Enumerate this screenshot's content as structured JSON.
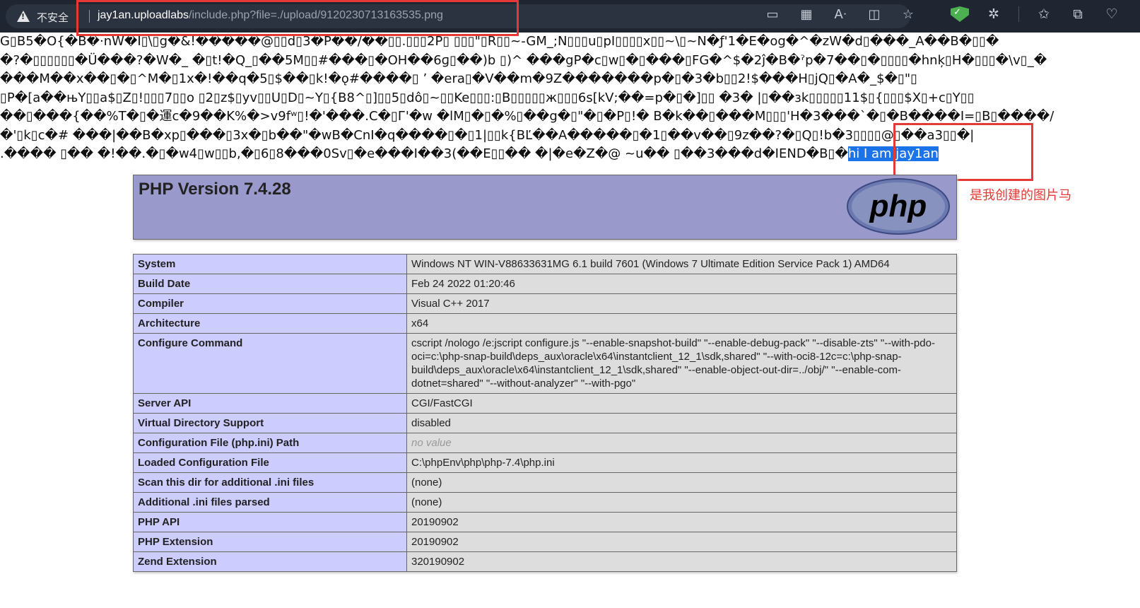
{
  "browser": {
    "insecure_label": "不安全",
    "url_host": "jay1an.uploadlabs",
    "url_path": "/include.php?file=./upload/9120230713163535.png",
    "toolbar_icons": [
      "display-icon",
      "apps-icon",
      "read-aloud-icon",
      "split-screen-icon",
      "favorite-star-icon"
    ],
    "extension_icons": [
      "shield-check-icon",
      "extensions-icon",
      "favorites-icon",
      "collections-icon",
      "heart-pulse-icon"
    ]
  },
  "garbage_lines": [
    "G▯B5�O{�B�·nW�I▯\\▯g�&!�����@▯▯d▯3�P��/��▯▯.▯▯▯2P▯ ▯▯▯\"▯R▯▯~-GM_;N▯▯▯u▯pI▯▯▯▯x▯▯~\\▯~N�ƒ'1�E�og�^�zW�d▯���_A��B�▯▯�",
    "�?�▯▯▯▯▯▯�Ü���?�W�_ �▯t!�Q_▯��5M▯▯#���▯�OH��6ɡ▯��)b ▯)^ ���gP�c▯w▯�▯���▯FG�^$�2ĵ�B�ˀp�7��▯�▯▯▯▯�hnķ▯H�▯▯▯�\\v▯_�",
    "���M��x��▯�▯^M�▯1x�!��q�5▯$��▯k!�ǫ#����▯ ʼ �era▯�V��m�9Z�������p�▯�3�b▯▯2!$���H▯jQ▯�A�_$�▯\"▯",
    "▯P�[a��њY▯▯a$▯Z▯!▯▯▯7▯▯o ▯2▯z$▯yv▯▯U▯D▯~Y▯{B8^▯]▯▯5▯dô▯~▯▯Ke▯▯▯:▯B▯▯▯▯▯ж▯▯▯6s[kV;��=p�▯�]▯▯ �3� |▯��зk▯▯▯▯▯11$▯{▯▯▯$X▯+c▯Y▯▯",
    "��▯���{��%T�▯�運c�9��K%�>v9fʷ▯!�'���.C�▯Г'�w �lM▯�▯�%▯��g�▯\"�▯�P▯!� B�k��▯���M▯▯▯'H�3���`�▯�B����I=▯B▯����/",
    "�'▯k▯c�# ���|��B�xp▯���▯3x�▯b��\"�wB�CnI�q����▯�▯1|▯▯k{BĽ��A�����▯�1▯��v��▯9z��?�▯Q▯!b�3▯▯▯▯@▯��a3▯▯�|",
    ".���� ▯�� �!��.�▯�w4▯w▯▯b,�▯6▯8���0Sv▯�e���I��3(��E▯▯�� �|�e�Z�@ ~u�� ▯��3���d�IEND�B▯�"
  ],
  "payload_text": "hi I am jay1an",
  "annotation": "是我创建的图片马",
  "php": {
    "title": "PHP Version 7.4.28",
    "logo_text": "php",
    "rows": [
      {
        "name": "System",
        "value": "Windows NT WIN-V88633631MG 6.1 build 7601 (Windows 7 Ultimate Edition Service Pack 1) AMD64"
      },
      {
        "name": "Build Date",
        "value": "Feb 24 2022 01:20:46"
      },
      {
        "name": "Compiler",
        "value": "Visual C++ 2017"
      },
      {
        "name": "Architecture",
        "value": "x64"
      },
      {
        "name": "Configure Command",
        "value": "cscript /nologo /e:jscript configure.js \"--enable-snapshot-build\" \"--enable-debug-pack\" \"--disable-zts\" \"--with-pdo-oci=c:\\php-snap-build\\deps_aux\\oracle\\x64\\instantclient_12_1\\sdk,shared\" \"--with-oci8-12c=c:\\php-snap-build\\deps_aux\\oracle\\x64\\instantclient_12_1\\sdk,shared\" \"--enable-object-out-dir=../obj/\" \"--enable-com-dotnet=shared\" \"--without-analyzer\" \"--with-pgo\""
      },
      {
        "name": "Server API",
        "value": "CGI/FastCGI"
      },
      {
        "name": "Virtual Directory Support",
        "value": "disabled"
      },
      {
        "name": "Configuration File (php.ini) Path",
        "value": "no value"
      },
      {
        "name": "Loaded Configuration File",
        "value": "C:\\phpEnv\\php\\php-7.4\\php.ini"
      },
      {
        "name": "Scan this dir for additional .ini files",
        "value": "(none)"
      },
      {
        "name": "Additional .ini files parsed",
        "value": "(none)"
      },
      {
        "name": "PHP API",
        "value": "20190902"
      },
      {
        "name": "PHP Extension",
        "value": "20190902"
      },
      {
        "name": "Zend Extension",
        "value": "320190902"
      }
    ]
  },
  "colors": {
    "highlight": "#e53935",
    "selection": "#1a73e8",
    "php_header": "#9999cc",
    "php_key_cell": "#ccccff",
    "php_value_cell": "#dddddd"
  }
}
